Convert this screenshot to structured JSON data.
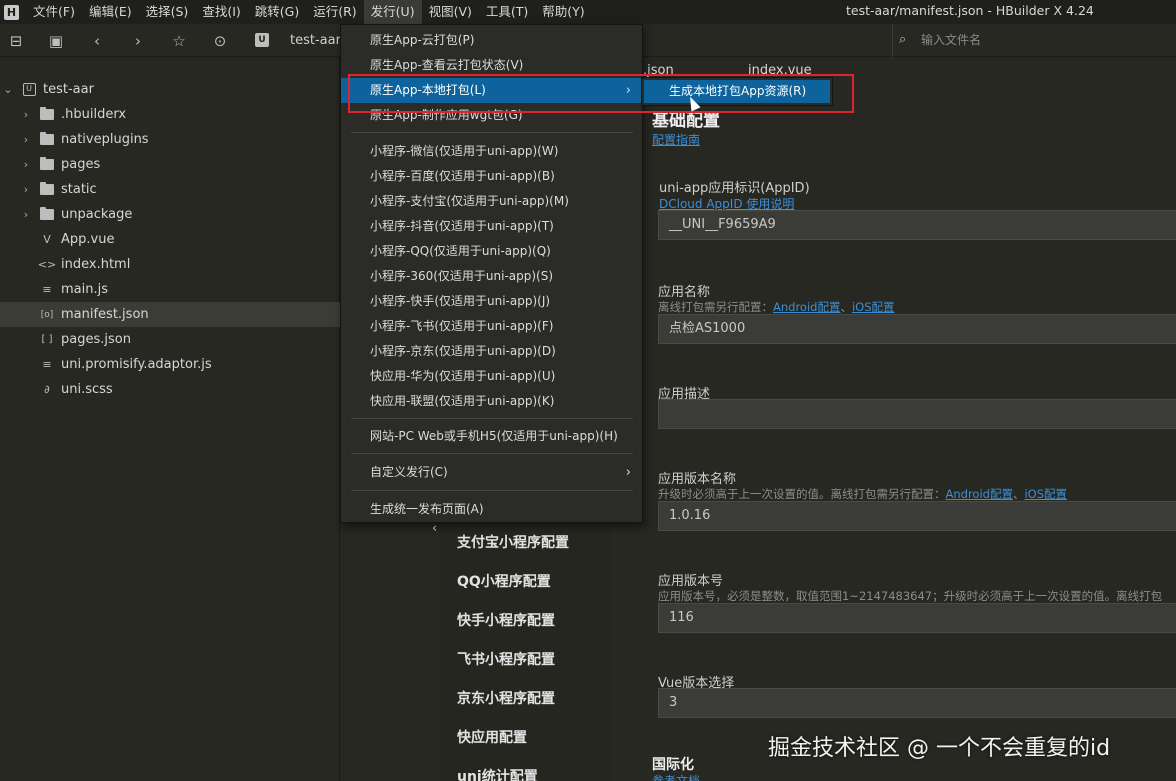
{
  "window_title": "test-aar/manifest.json - HBuilder X 4.24",
  "app_logo": "H",
  "menubar": [
    "文件(F)",
    "编辑(E)",
    "选择(S)",
    "查找(I)",
    "跳转(G)",
    "运行(R)",
    "发行(U)",
    "视图(V)",
    "工具(T)",
    "帮助(Y)"
  ],
  "toolbar": {
    "icons": [
      "new-file-icon",
      "save-icon",
      "back-icon",
      "forward-icon",
      "favorite-icon",
      "run-icon"
    ],
    "project_badge": "U",
    "crumb": "test-aar",
    "file_search_placeholder": "输入文件名"
  },
  "sidebar": {
    "project": "test-aar",
    "items": [
      {
        "label": ".hbuilderx",
        "type": "folder"
      },
      {
        "label": "nativeplugins",
        "type": "folder"
      },
      {
        "label": "pages",
        "type": "folder"
      },
      {
        "label": "static",
        "type": "folder"
      },
      {
        "label": "unpackage",
        "type": "folder"
      },
      {
        "label": "App.vue",
        "type": "vue",
        "icon": "V"
      },
      {
        "label": "index.html",
        "type": "html",
        "icon": "<>"
      },
      {
        "label": "main.js",
        "type": "js",
        "icon": "≡"
      },
      {
        "label": "manifest.json",
        "type": "json",
        "icon": "[o]",
        "selected": true
      },
      {
        "label": "pages.json",
        "type": "json",
        "icon": "[ ]"
      },
      {
        "label": "uni.promisify.adaptor.js",
        "type": "js",
        "icon": "≡"
      },
      {
        "label": "uni.scss",
        "type": "scss",
        "icon": "∂"
      }
    ]
  },
  "tabs": [
    ".json",
    "index.vue"
  ],
  "release_menu": {
    "groups": [
      [
        "原生App-云打包(P)",
        "原生App-查看云打包状态(V)",
        "原生App-本地打包(L)",
        "原生App-制作应用wgt包(G)"
      ],
      [
        "小程序-微信(仅适用于uni-app)(W)",
        "小程序-百度(仅适用于uni-app)(B)",
        "小程序-支付宝(仅适用于uni-app)(M)",
        "小程序-抖音(仅适用于uni-app)(T)",
        "小程序-QQ(仅适用于uni-app)(Q)",
        "小程序-360(仅适用于uni-app)(S)",
        "小程序-快手(仅适用于uni-app)(J)",
        "小程序-飞书(仅适用于uni-app)(F)",
        "小程序-京东(仅适用于uni-app)(D)",
        "快应用-华为(仅适用于uni-app)(U)",
        "快应用-联盟(仅适用于uni-app)(K)"
      ],
      [
        "网站-PC Web或手机H5(仅适用于uni-app)(H)"
      ],
      [
        "自定义发行(C)"
      ],
      [
        "生成统一发布页面(A)"
      ]
    ],
    "highlighted": "原生App-本地打包(L)",
    "submenu_item": "生成本地打包App资源(R)"
  },
  "config_nav": [
    "支付宝小程序配置",
    "QQ小程序配置",
    "快手小程序配置",
    "飞书小程序配置",
    "京东小程序配置",
    "快应用配置",
    "uni统计配置"
  ],
  "form": {
    "section_title": "基础配置",
    "section_link": "配置指南",
    "appid_label": "uni-app应用标识(AppID)",
    "appid_link": "DCloud AppID 使用说明",
    "appid_value": "__UNI__F9659A9",
    "name_label": "应用名称",
    "name_hint": "离线打包需另行配置：",
    "android_link": "Android配置",
    "ios_link": "iOS配置",
    "name_value": "点检AS1000",
    "desc_label": "应用描述",
    "desc_value": "",
    "version_name_label": "应用版本名称",
    "version_name_hint": "升级时必须高于上一次设置的值。离线打包需另行配置：",
    "version_name_value": "1.0.16",
    "version_code_label": "应用版本号",
    "version_code_hint": "应用版本号，必须是整数，取值范围1~2147483647；升级时必须高于上一次设置的值。离线打包",
    "version_code_value": "116",
    "vue_label": "Vue版本选择",
    "vue_value": "3",
    "i18n_title": "国际化",
    "i18n_link": "参考文档"
  },
  "watermark": "掘金技术社区 @ 一个不会重复的id"
}
